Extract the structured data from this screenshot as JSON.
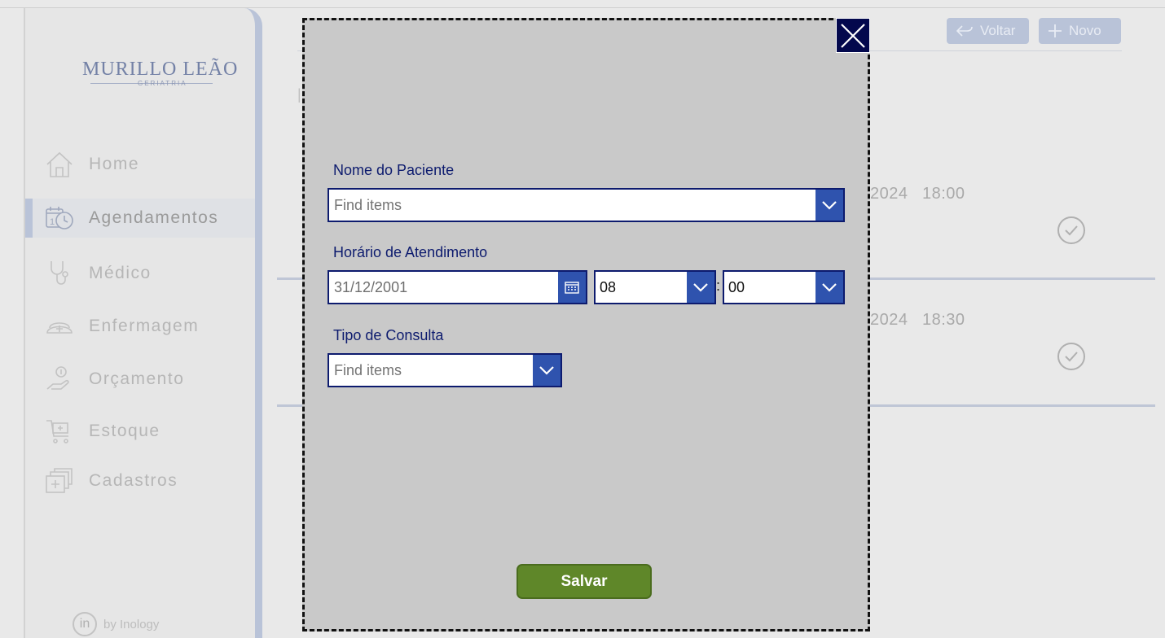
{
  "sidebar": {
    "logo": {
      "main": "MURILLO LEÃO",
      "sub": "GERIATRIA"
    },
    "items": [
      {
        "label": "Home",
        "icon": "home-icon"
      },
      {
        "label": "Agendamentos",
        "icon": "calendar-clock-icon",
        "active": true
      },
      {
        "label": "Médico",
        "icon": "stethoscope-icon"
      },
      {
        "label": "Enfermagem",
        "icon": "nurse-cap-icon"
      },
      {
        "label": "Orçamento",
        "icon": "money-hand-icon"
      },
      {
        "label": "Estoque",
        "icon": "medical-cart-icon"
      },
      {
        "label": "Cadastros",
        "icon": "stacked-cards-icon"
      }
    ],
    "byline": "by Inology",
    "byline_glyph": "in"
  },
  "header": {
    "back_label": "Voltar",
    "new_label": "Novo"
  },
  "background_rows": [
    {
      "date_fragment": "2024",
      "time": "18:00"
    },
    {
      "date_fragment": "2024",
      "time": "18:30"
    }
  ],
  "modal": {
    "patient_label": "Nome do Paciente",
    "patient_placeholder": "Find items",
    "schedule_label": "Horário de Atendimento",
    "date_value": "31/12/2001",
    "hour_value": "08",
    "time_separator": ":",
    "minute_value": "00",
    "type_label": "Tipo de Consulta",
    "type_placeholder": "Find items",
    "save_label": "Salvar"
  },
  "colors": {
    "modal_bg": "#c9c9c9",
    "accent_blue": "#2f53ae",
    "label_navy": "#0d1b6e",
    "close_bg": "#03084d",
    "save_green": "#5f8729",
    "sidebar_accent": "#b9c3d8"
  }
}
